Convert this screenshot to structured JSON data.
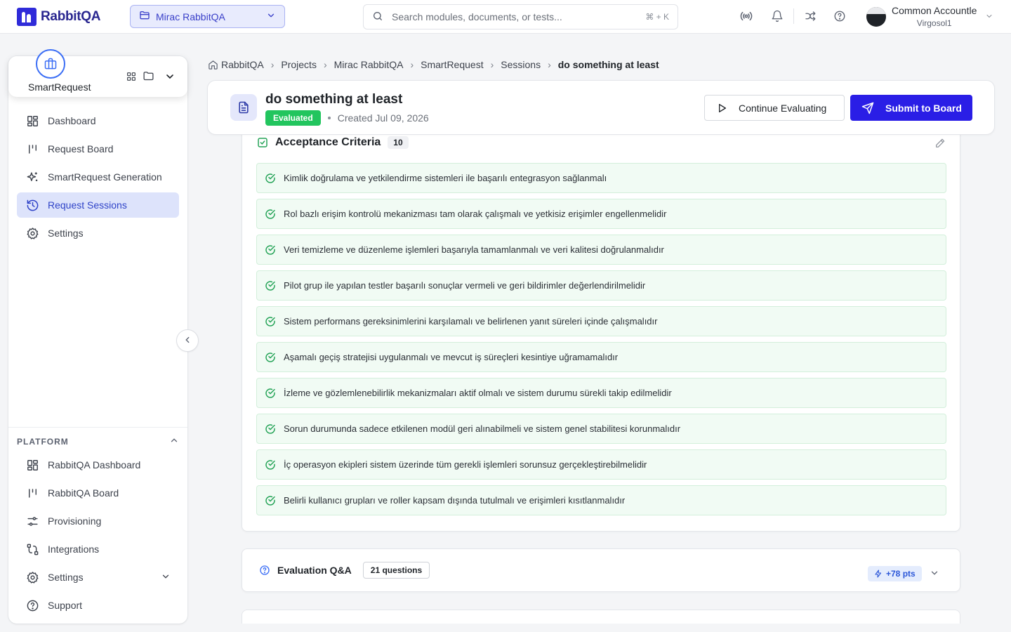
{
  "app": {
    "name": "RabbitQA"
  },
  "project_selector": {
    "label": "Mirac RabbitQA"
  },
  "search": {
    "placeholder": "Search modules, documents, or tests...",
    "shortcut": "⌘ + K"
  },
  "account": {
    "name": "Common Accountle",
    "org": "Virgosol1"
  },
  "module": {
    "name": "SmartRequest"
  },
  "nav": {
    "items": [
      {
        "label": "Dashboard",
        "icon": "grid-icon"
      },
      {
        "label": "Request Board",
        "icon": "board-icon"
      },
      {
        "label": "SmartRequest Generation",
        "icon": "sparkles-icon"
      },
      {
        "label": "Request Sessions",
        "icon": "history-icon",
        "active": true
      },
      {
        "label": "Settings",
        "icon": "gear-icon"
      }
    ]
  },
  "platform": {
    "heading": "PLATFORM",
    "items": [
      {
        "label": "RabbitQA Dashboard",
        "icon": "grid-icon"
      },
      {
        "label": "RabbitQA Board",
        "icon": "board-icon"
      },
      {
        "label": "Provisioning",
        "icon": "sliders-icon"
      },
      {
        "label": "Integrations",
        "icon": "route-icon"
      },
      {
        "label": "Settings",
        "icon": "gear-icon"
      },
      {
        "label": "Support",
        "icon": "help-icon"
      }
    ]
  },
  "breadcrumb": [
    "RabbitQA",
    "Projects",
    "Mirac RabbitQA",
    "SmartRequest",
    "Sessions",
    "do something at least"
  ],
  "session": {
    "title": "do something at least",
    "status": "Evaluated",
    "created": "Created Jul 09, 2026",
    "continue_label": "Continue Evaluating",
    "submit_label": "Submit to Board"
  },
  "acceptance": {
    "title": "Acceptance Criteria",
    "count": "10",
    "items": [
      "Kimlik doğrulama ve yetkilendirme sistemleri ile başarılı entegrasyon sağlanmalı",
      "Rol bazlı erişim kontrolü mekanizması tam olarak çalışmalı ve yetkisiz erişimler engellenmelidir",
      "Veri temizleme ve düzenleme işlemleri başarıyla tamamlanmalı ve veri kalitesi doğrulanmalıdır",
      "Pilot grup ile yapılan testler başarılı sonuçlar vermeli ve geri bildirimler değerlendirilmelidir",
      "Sistem performans gereksinimlerini karşılamalı ve belirlenen yanıt süreleri içinde çalışmalıdır",
      "Aşamalı geçiş stratejisi uygulanmalı ve mevcut iş süreçleri kesintiye uğramamalıdır",
      "İzleme ve gözlemlenebilirlik mekanizmaları aktif olmalı ve sistem durumu sürekli takip edilmelidir",
      "Sorun durumunda sadece etkilenen modül geri alınabilmeli ve sistem genel stabilitesi korunmalıdır",
      "İç operasyon ekipleri sistem üzerinde tüm gerekli işlemleri sorunsuz gerçekleştirebilmelidir",
      "Belirli kullanıcı grupları ve roller kapsam dışında tutulmalı ve erişimleri kısıtlanmalıdır"
    ]
  },
  "qa": {
    "title": "Evaluation Q&A",
    "count": "21 questions",
    "points": "+78 pts"
  },
  "colors": {
    "brand": "#2f2bd9",
    "primary_button": "#2a1ee6",
    "evaluated": "#22c55e",
    "criteria_bg": "#f1fbf4",
    "active_nav": "#dde3fb"
  }
}
